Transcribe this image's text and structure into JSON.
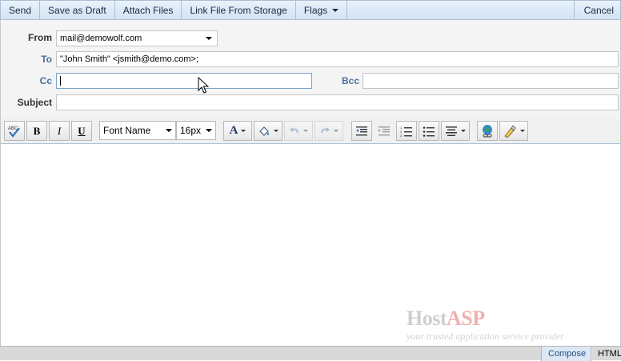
{
  "toolbar": {
    "send": "Send",
    "save_draft": "Save as Draft",
    "attach_files": "Attach Files",
    "link_file": "Link File From Storage",
    "flags": "Flags",
    "cancel": "Cancel"
  },
  "header": {
    "from_label": "From",
    "from_value": "mail@demowolf.com",
    "to_label": "To",
    "to_value": "\"John Smith\" <jsmith@demo.com>;",
    "cc_label": "Cc",
    "cc_value": "",
    "bcc_label": "Bcc",
    "bcc_value": "",
    "subject_label": "Subject",
    "subject_value": ""
  },
  "format_toolbar": {
    "font_name": "Font Name",
    "font_size": "16px",
    "icons": [
      "spellcheck-icon",
      "bold-icon",
      "italic-icon",
      "underline-icon",
      "font-color-icon",
      "highlight-color-icon",
      "undo-icon",
      "redo-icon",
      "outdent-icon",
      "indent-icon",
      "ordered-list-icon",
      "unordered-list-icon",
      "align-icon",
      "insert-link-icon",
      "clear-format-icon"
    ]
  },
  "watermark": {
    "brand_host": "Host",
    "brand_asp": "ASP",
    "tagline": "your trusted application service provider"
  },
  "statusbar": {
    "compose": "Compose",
    "html": "HTML"
  },
  "colors": {
    "toolbar_bg": "#dbe7f5",
    "label_blue": "#4a6e9a",
    "brand_red": "#f1b1b1"
  }
}
